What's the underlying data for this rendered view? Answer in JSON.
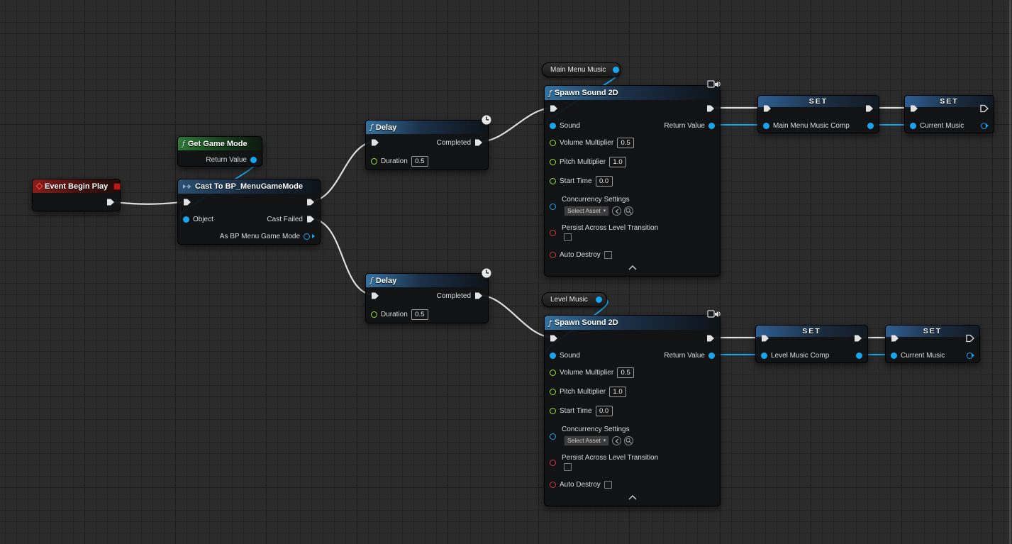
{
  "app": "Unreal Engine Blueprint Graph",
  "nodes": {
    "event_begin_play": {
      "title": "Event Begin Play"
    },
    "get_game_mode": {
      "title": "Get Game Mode",
      "return_label": "Return Value"
    },
    "cast": {
      "title": "Cast To BP_MenuGameMode",
      "object_label": "Object",
      "cast_failed_label": "Cast Failed",
      "as_label": "As BP Menu Game Mode"
    },
    "delay": {
      "title": "Delay",
      "completed_label": "Completed",
      "duration_label": "Duration",
      "duration_value": "0.5"
    },
    "spawn_sound_2d": {
      "title": "Spawn Sound 2D",
      "sound_label": "Sound",
      "return_label": "Return Value",
      "volume_label": "Volume Multiplier",
      "volume_value": "0.5",
      "pitch_label": "Pitch Multiplier",
      "pitch_value": "1.0",
      "start_time_label": "Start Time",
      "start_time_value": "0.0",
      "concurrency_label": "Concurrency Settings",
      "concurrency_select": "Select Asset",
      "persist_label": "Persist Across Level Transition",
      "auto_destroy_label": "Auto Destroy"
    },
    "variables": {
      "main_menu_music": "Main Menu Music",
      "level_music": "Level Music"
    },
    "set_nodes": {
      "set_label": "SET",
      "main_menu_music_comp": "Main Menu Music Comp",
      "level_music_comp": "Level Music Comp",
      "current_music": "Current Music"
    }
  },
  "colors": {
    "background": "#2b2b2b",
    "exec_wire": "#dfdfdf",
    "object_pin": "#18a6f0",
    "float_pin": "#97e82f",
    "bool_pin": "#d23b3b",
    "event_header": "#8a1f1a",
    "pure_function_header": "#2d7a35",
    "cast_header": "#2a4f71",
    "function_header": "#35719f",
    "set_header": "#2f5f93"
  }
}
